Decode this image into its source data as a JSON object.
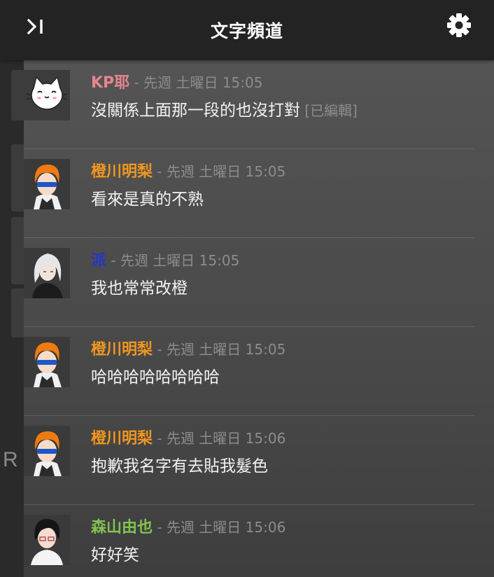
{
  "header": {
    "title": "文字頻道",
    "collapse_icon": "collapse-panel-icon",
    "settings_icon": "gear-icon"
  },
  "side_hint": "R",
  "colors": {
    "kp": "#e8858f",
    "orange": "#f0961e",
    "blue": "#2236c8",
    "green": "#82c250"
  },
  "messages": [
    {
      "author": "KP耶",
      "time": " - 先週 土曜日 15:05",
      "text": "沒關係上面那一段的也沒打對",
      "edited": " [已編輯]",
      "avatar": "white-cat-avatar"
    },
    {
      "author": "橙川明梨",
      "time": " - 先週 土曜日 15:05",
      "text": "看來是真的不熟",
      "edited": "",
      "avatar": "orange-hair-avatar"
    },
    {
      "author": "派",
      "time": " - 先週 土曜日 15:05",
      "text": "我也常常改橙",
      "edited": "",
      "avatar": "white-hair-avatar"
    },
    {
      "author": "橙川明梨",
      "time": " - 先週 土曜日 15:05",
      "text": "哈哈哈哈哈哈哈哈",
      "edited": "",
      "avatar": "orange-hair-avatar"
    },
    {
      "author": "橙川明梨",
      "time": " - 先週 土曜日 15:06",
      "text": "抱歉我名字有去貼我髮色",
      "edited": "",
      "avatar": "orange-hair-avatar"
    },
    {
      "author": "森山由也",
      "time": " - 先週 土曜日 15:06",
      "text": "好好笑",
      "edited": "",
      "avatar": "black-hair-avatar"
    }
  ]
}
